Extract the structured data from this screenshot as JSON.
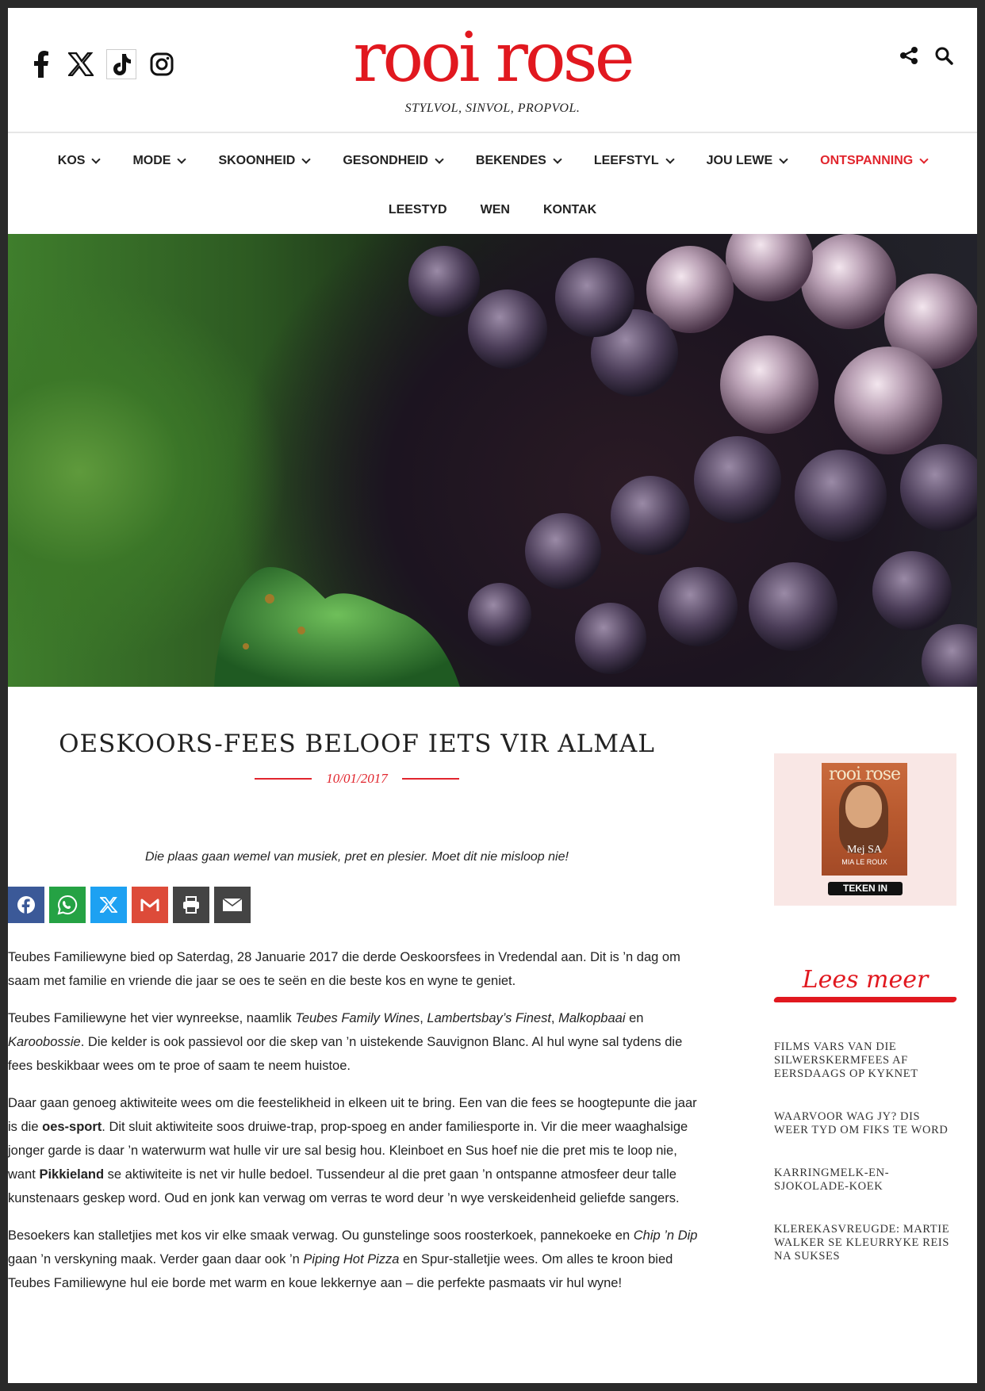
{
  "header": {
    "logo": "rooi rose",
    "tagline": "STYLVOL, SINVOL, PROPVOL.",
    "social_icons": [
      "facebook-icon",
      "x-icon",
      "tiktok-icon",
      "instagram-icon"
    ],
    "tool_icons": [
      "share-icon",
      "search-icon"
    ]
  },
  "nav": {
    "row1": [
      "KOS",
      "MODE",
      "SKOONHEID",
      "GESONDHEID",
      "BEKENDES",
      "LEEFSTYL",
      "JOU LEWE",
      "ONTSPANNING"
    ],
    "row2": [
      "LEESTYD",
      "WEN",
      "KONTAK"
    ],
    "active": "ONTSPANNING"
  },
  "article": {
    "title": "OESKOORS-FEES BELOOF IETS VIR ALMAL",
    "date": "10/01/2017",
    "lead": "Die plaas gaan wemel van musiek, pret en plesier. Moet dit nie misloop nie!",
    "share_buttons": [
      "facebook-icon",
      "whatsapp-icon",
      "x-icon",
      "gmail-icon",
      "print-icon",
      "email-icon"
    ],
    "p1": "Teubes Familiewyne bied op Saterdag, 28 Januarie 2017 die derde Oeskoorsfees in Vredendal aan. Dit is ’n dag om saam met familie en vriende die jaar se oes te seën en die beste kos en wyne te geniet.",
    "p2": {
      "a": "Teubes Familiewyne het vier wynreekse, naamlik ",
      "i1": "Teubes Family Wines",
      "b": ", ",
      "i2": "Lambertsbay’s Finest",
      "c": ", ",
      "i3": "Malkopbaai",
      "d": " en ",
      "i4": "Karoobossie",
      "e": ". Die kelder is ook passievol oor die skep van ’n uistekende Sauvignon Blanc. Al hul wyne sal tydens die fees beskikbaar wees om te proe of saam te neem huistoe."
    },
    "p3": {
      "a": "Daar gaan genoeg aktiwiteite wees om die feestelikheid in elkeen uit te bring. Een van die fees se hoogtepunte die jaar is die ",
      "b1": "oes-sport",
      "b": ". Dit sluit aktiwiteite soos druiwe-trap, prop-spoeg en ander familiesporte in. Vir die meer waaghalsige jonger garde is daar ’n waterwurm wat hulle vir ure sal besig hou. Kleinboet en Sus hoef nie die pret mis te loop nie, want ",
      "b2": "Pikkieland",
      "c": " se aktiwiteite is net vir hulle bedoel. Tussendeur al die pret gaan ’n ontspanne atmosfeer deur talle kunstenaars geskep word. Oud en jonk kan verwag om verras te word deur ’n wye verskeidenheid geliefde sangers."
    },
    "p4": {
      "a": "Besoekers kan stalletjies met kos vir elke smaak verwag. Ou gunstelinge soos roosterkoek, pannekoeke en ",
      "i1": "Chip ’n Dip",
      "b": " gaan ’n verskyning maak. Verder gaan daar ook ’n ",
      "i2": "Piping Hot Pizza",
      "c": " en Spur-stalletjie wees. Om alles te kroon bied Teubes Familiewyne hul eie borde met warm en koue lekkernye aan – die perfekte pasmaats vir hul wyne!"
    }
  },
  "sidebar": {
    "magazine": {
      "title": "rooi rose",
      "cover_name": "Mej SA",
      "cover_sub": "MIA LE ROUX",
      "button": "TEKEN IN"
    },
    "lees_meer": "Lees meer",
    "related": [
      "FILMS VARS VAN DIE SILWERSKERMFEES AF EERSDAAGS OP KYKNET",
      "WAARVOOR WAG JY? DIS WEER TYD OM FIKS TE WORD",
      "KARRINGMELK-EN-SJOKOLADE-KOEK",
      "KLEREKASVREUGDE: MARTIE WALKER SE KLEURRYKE REIS NA SUKSES"
    ]
  },
  "colors": {
    "brand_red": "#e1181f",
    "facebook": "#3b5998",
    "whatsapp": "#25a244",
    "x": "#1da1f2",
    "gmail": "#dd4b39",
    "print": "#444444",
    "email": "#444444"
  }
}
